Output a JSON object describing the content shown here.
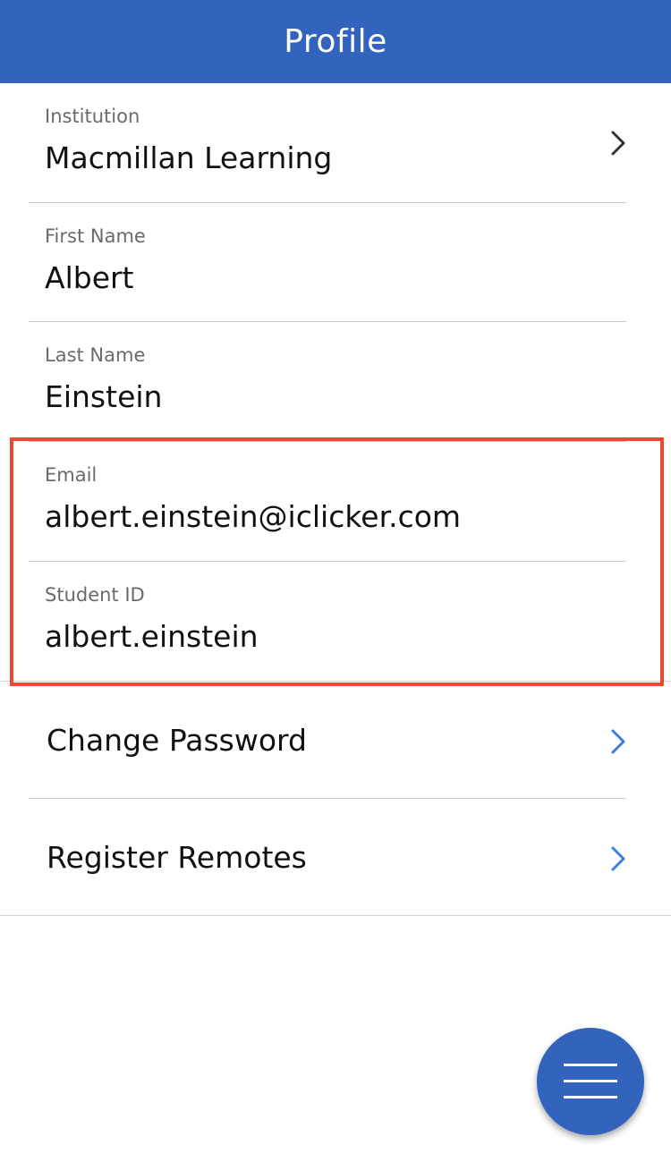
{
  "header": {
    "title": "Profile"
  },
  "fields": {
    "institution": {
      "label": "Institution",
      "value": "Macmillan Learning"
    },
    "first_name": {
      "label": "First Name",
      "value": "Albert"
    },
    "last_name": {
      "label": "Last Name",
      "value": "Einstein"
    },
    "email": {
      "label": "Email",
      "value": "albert.einstein@iclicker.com"
    },
    "student_id": {
      "label": "Student ID",
      "value": "albert.einstein"
    }
  },
  "actions": {
    "change_password": {
      "label": "Change Password"
    },
    "register_remotes": {
      "label": "Register Remotes"
    }
  },
  "icons": {
    "institution_chevron": "chevron-right-icon",
    "action_chevron": "chevron-right-icon",
    "menu": "hamburger-menu-icon"
  },
  "colors": {
    "brand": "#3264bd",
    "highlight": "#ea4a2f",
    "action_chevron": "#3a7de0"
  }
}
